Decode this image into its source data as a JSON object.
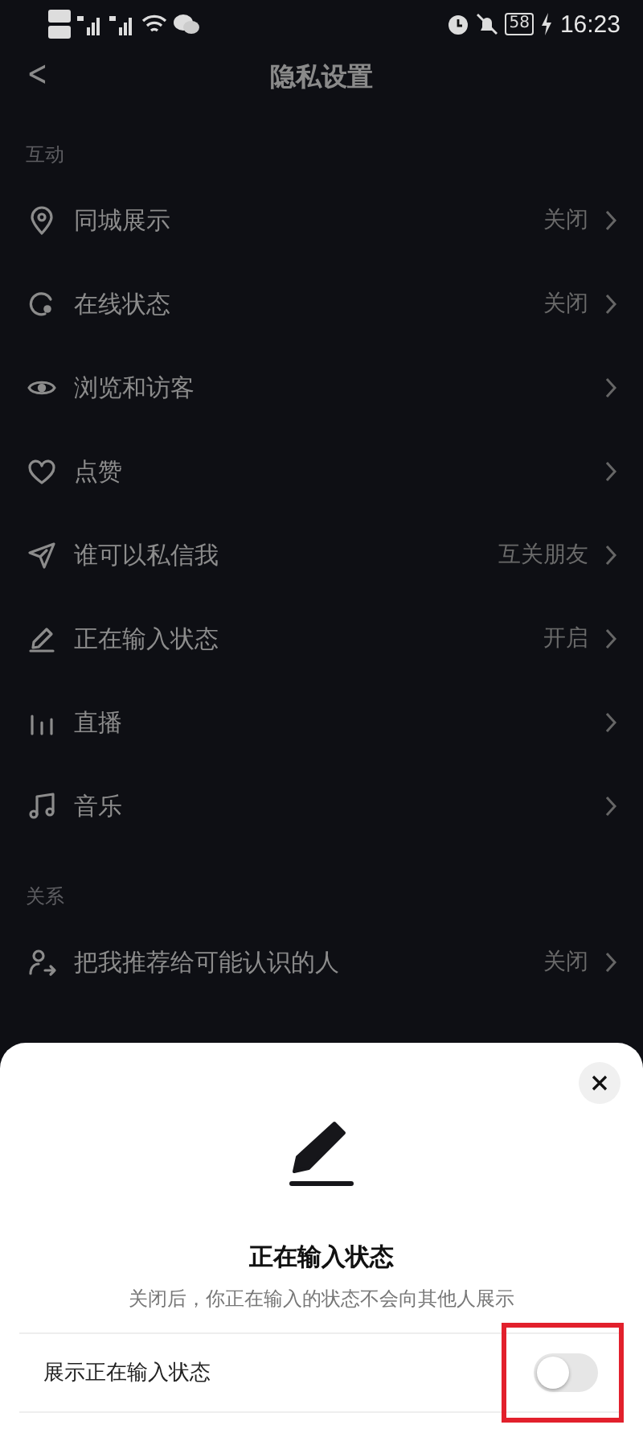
{
  "status_bar": {
    "time": "16:23",
    "battery": "58"
  },
  "header": {
    "back": "<",
    "title": "隐私设置"
  },
  "sections": [
    {
      "title": "互动",
      "items": [
        {
          "label": "同城展示",
          "value": "关闭"
        },
        {
          "label": "在线状态",
          "value": "关闭"
        },
        {
          "label": "浏览和访客"
        },
        {
          "label": "点赞"
        },
        {
          "label": "谁可以私信我",
          "value": "互关朋友"
        },
        {
          "label": "正在输入状态",
          "value": "开启"
        },
        {
          "label": "直播"
        },
        {
          "label": "音乐"
        }
      ]
    },
    {
      "title": "关系",
      "items": [
        {
          "label": "把我推荐给可能认识的人",
          "value": "关闭"
        }
      ]
    }
  ],
  "sheet": {
    "title": "正在输入状态",
    "description": "关闭后，你正在输入的状态不会向其他人展示",
    "options": [
      {
        "label": "展示正在输入状态",
        "on": false
      }
    ]
  }
}
